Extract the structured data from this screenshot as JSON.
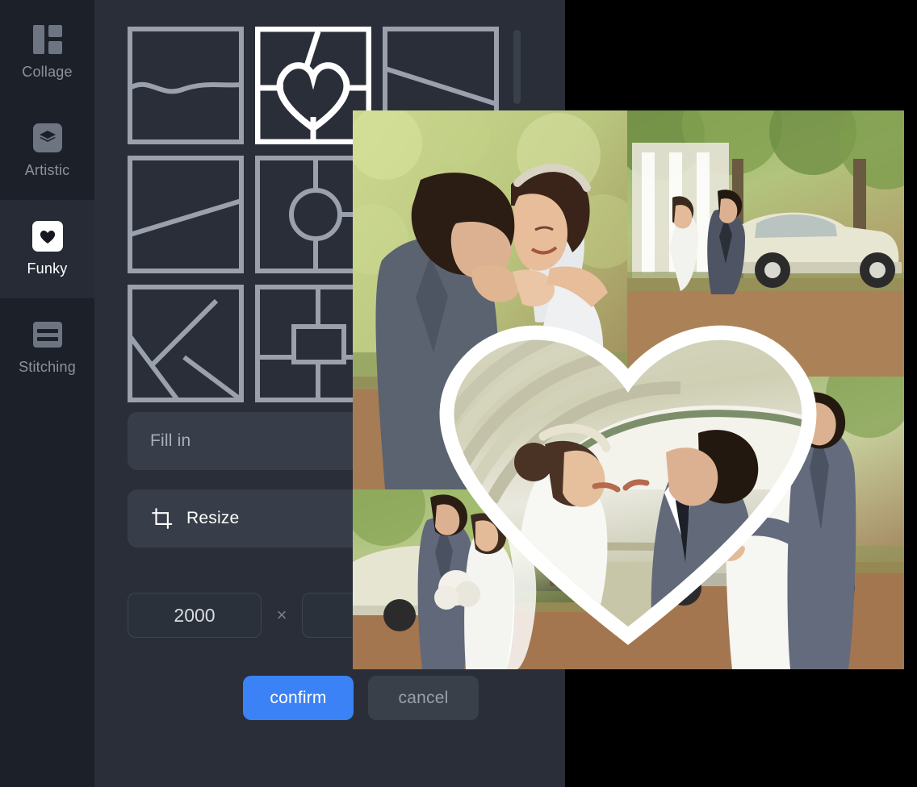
{
  "app": {
    "window_background": "#292e38",
    "sidebar_background": "#1c2029",
    "accent_color": "#3b82f6"
  },
  "sidebar": {
    "items": [
      {
        "id": "collage",
        "label": "Collage",
        "icon": "collage-icon",
        "selected": false
      },
      {
        "id": "artistic",
        "label": "Artistic",
        "icon": "layers-icon",
        "selected": false
      },
      {
        "id": "funky",
        "label": "Funky",
        "icon": "heart-icon",
        "selected": true
      },
      {
        "id": "stitching",
        "label": "Stitching",
        "icon": "stitching-icon",
        "selected": false
      }
    ]
  },
  "templates": {
    "items": [
      {
        "id": "tpl-wave",
        "shape": "wave",
        "selected": false
      },
      {
        "id": "tpl-heart",
        "shape": "heart",
        "selected": true
      },
      {
        "id": "tpl-diagonal",
        "shape": "diagonal-a",
        "selected": false
      },
      {
        "id": "tpl-slant",
        "shape": "slant",
        "selected": false
      },
      {
        "id": "tpl-circle",
        "shape": "circle",
        "selected": false
      },
      {
        "id": "tpl-r2c3",
        "shape": "blank",
        "selected": false
      },
      {
        "id": "tpl-zigzag",
        "shape": "zigzag",
        "selected": false
      },
      {
        "id": "tpl-box",
        "shape": "center-box",
        "selected": false
      },
      {
        "id": "tpl-r3c3",
        "shape": "blank",
        "selected": false
      }
    ]
  },
  "options": {
    "fill_in_label": "Fill in",
    "resize_label": "Resize",
    "resize_icon": "crop-icon"
  },
  "size": {
    "width_value": "2000",
    "width_placeholder": "2000",
    "separator": "×",
    "height_value": "",
    "height_placeholder": ""
  },
  "actions": {
    "confirm_label": "confirm",
    "cancel_label": "cancel"
  },
  "preview": {
    "alt": "wedding heart collage preview"
  }
}
